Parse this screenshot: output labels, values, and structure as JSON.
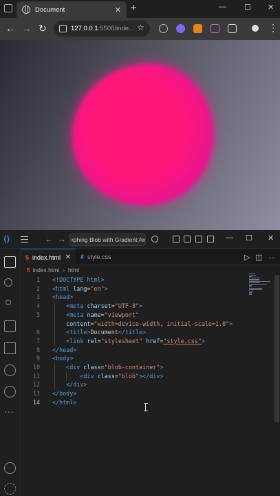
{
  "browser": {
    "tab_title": "Document",
    "tab_close": "✕",
    "new_tab": "+",
    "url_host": "127.0.0.1",
    "url_rest": ":5500/inde...",
    "back": "←",
    "forward": "→",
    "reload": "↻",
    "star": "☆",
    "window_controls": {
      "minimize": "—",
      "restore": "☐",
      "close": "✕"
    }
  },
  "page": {
    "title": "Morphing Blob with Gradient Animation",
    "blob_colors": [
      "#ff1571",
      "#e51592",
      "#b8209c"
    ],
    "background_colors": [
      "#2a2a36",
      "#8f8ea2"
    ]
  },
  "vscode": {
    "command_center": "rphing Blob with Gradient Ani",
    "window_controls": {
      "minimize": "—",
      "restore": "☐",
      "close": "✕"
    },
    "tabs": [
      {
        "label": "index.html",
        "icon": "html-file-icon",
        "active": true,
        "close": "✕"
      },
      {
        "label": "style.css",
        "icon": "css-file-icon",
        "active": false
      }
    ],
    "breadcrumb": [
      "index.html",
      "html"
    ],
    "editor_actions": {
      "run": "▷",
      "split": "◫",
      "more": "…"
    },
    "accent_color": "#0078d4",
    "cursor_line": 14,
    "code_lines": [
      {
        "n": "1",
        "parts": [
          [
            "tg",
            "<!DOCTYPE html>"
          ]
        ]
      },
      {
        "n": "2",
        "parts": [
          [
            "tg",
            "<html "
          ],
          [
            "at",
            "lang"
          ],
          [
            "ex",
            "="
          ],
          [
            "st",
            "\"en\""
          ],
          [
            "tg",
            ">"
          ]
        ]
      },
      {
        "n": "3",
        "parts": [
          [
            "tg",
            "<head>"
          ]
        ]
      },
      {
        "n": "4",
        "parts": [
          [
            "ex",
            "    "
          ],
          [
            "tg",
            "<meta "
          ],
          [
            "at",
            "charset"
          ],
          [
            "ex",
            "="
          ],
          [
            "st",
            "\"UTF-8\""
          ],
          [
            "tg",
            ">"
          ]
        ]
      },
      {
        "n": "5",
        "parts": [
          [
            "ex",
            "    "
          ],
          [
            "tg",
            "<meta "
          ],
          [
            "at",
            "name"
          ],
          [
            "ex",
            "="
          ],
          [
            "st",
            "\"viewport\""
          ]
        ]
      },
      {
        "n": "",
        "parts": [
          [
            "ex",
            "    "
          ],
          [
            "at",
            "content"
          ],
          [
            "ex",
            "="
          ],
          [
            "st",
            "\"width=device-width, initial-scale=1.0\""
          ],
          [
            "tg",
            ">"
          ]
        ]
      },
      {
        "n": "6",
        "parts": [
          [
            "ex",
            "    "
          ],
          [
            "tg",
            "<title>"
          ],
          [
            "ex",
            "Document"
          ],
          [
            "tg",
            "</title>"
          ]
        ]
      },
      {
        "n": "7",
        "parts": [
          [
            "ex",
            "    "
          ],
          [
            "tg",
            "<link "
          ],
          [
            "at",
            "rel"
          ],
          [
            "ex",
            "="
          ],
          [
            "st",
            "\"stylesheet\""
          ],
          [
            "ex",
            " "
          ],
          [
            "at",
            "href"
          ],
          [
            "ex",
            "="
          ],
          [
            "st",
            "\"style.css\""
          ],
          [
            "tg",
            ">"
          ]
        ]
      },
      {
        "n": "8",
        "parts": [
          [
            "tg",
            "</head>"
          ]
        ]
      },
      {
        "n": "9",
        "parts": [
          [
            "tg",
            "<body>"
          ]
        ]
      },
      {
        "n": "10",
        "parts": [
          [
            "ex",
            "    "
          ],
          [
            "tg",
            "<div "
          ],
          [
            "at",
            "class"
          ],
          [
            "ex",
            "="
          ],
          [
            "st",
            "\"blob-container\""
          ],
          [
            "tg",
            ">"
          ]
        ]
      },
      {
        "n": "11",
        "parts": [
          [
            "ex",
            "        "
          ],
          [
            "tg",
            "<div "
          ],
          [
            "at",
            "class"
          ],
          [
            "ex",
            "="
          ],
          [
            "st",
            "\"blob\""
          ],
          [
            "tg",
            "></div>"
          ]
        ]
      },
      {
        "n": "12",
        "parts": [
          [
            "ex",
            "    "
          ],
          [
            "tg",
            "</div>"
          ]
        ]
      },
      {
        "n": "13",
        "parts": [
          [
            "tg",
            "</body>"
          ]
        ]
      },
      {
        "n": "14",
        "parts": [
          [
            "tg",
            "</html>"
          ]
        ]
      }
    ]
  }
}
